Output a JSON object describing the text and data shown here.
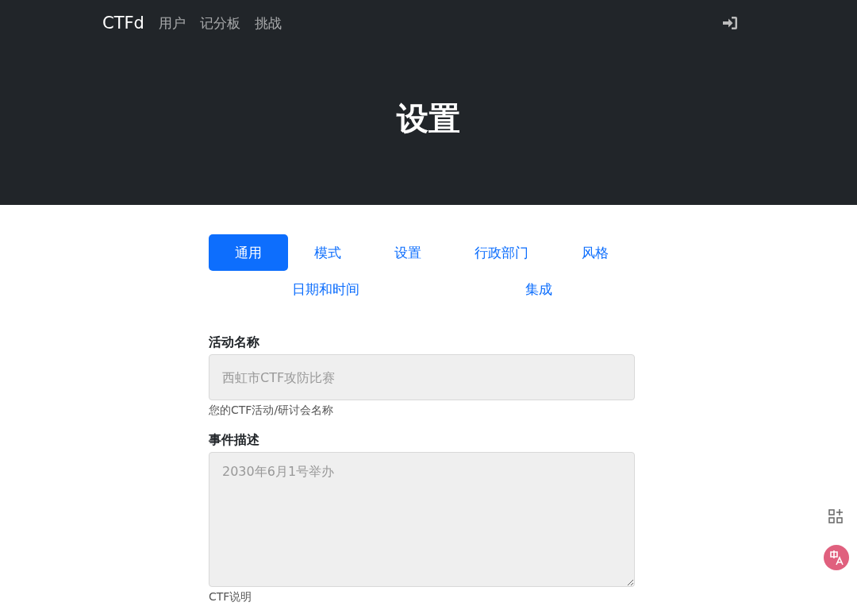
{
  "navbar": {
    "brand": "CTFd",
    "links": [
      "用户",
      "记分板",
      "挑战"
    ]
  },
  "header": {
    "title": "设置"
  },
  "tabs": [
    {
      "label": "通用",
      "selected": true
    },
    {
      "label": "模式",
      "selected": false
    },
    {
      "label": "设置",
      "selected": false
    },
    {
      "label": "行政部门",
      "selected": false
    },
    {
      "label": "风格",
      "selected": false
    },
    {
      "label": "日期和时间",
      "selected": false
    },
    {
      "label": "集成",
      "selected": false
    }
  ],
  "fields": [
    {
      "kind": "input",
      "label": "活动名称",
      "placeholder": "西虹市CTF攻防比赛",
      "help": "您的CTF活动/研讨会名称"
    },
    {
      "kind": "textarea",
      "label": "事件描述",
      "placeholder": "2030年6月1号举办",
      "help": "CTF说明"
    }
  ]
}
